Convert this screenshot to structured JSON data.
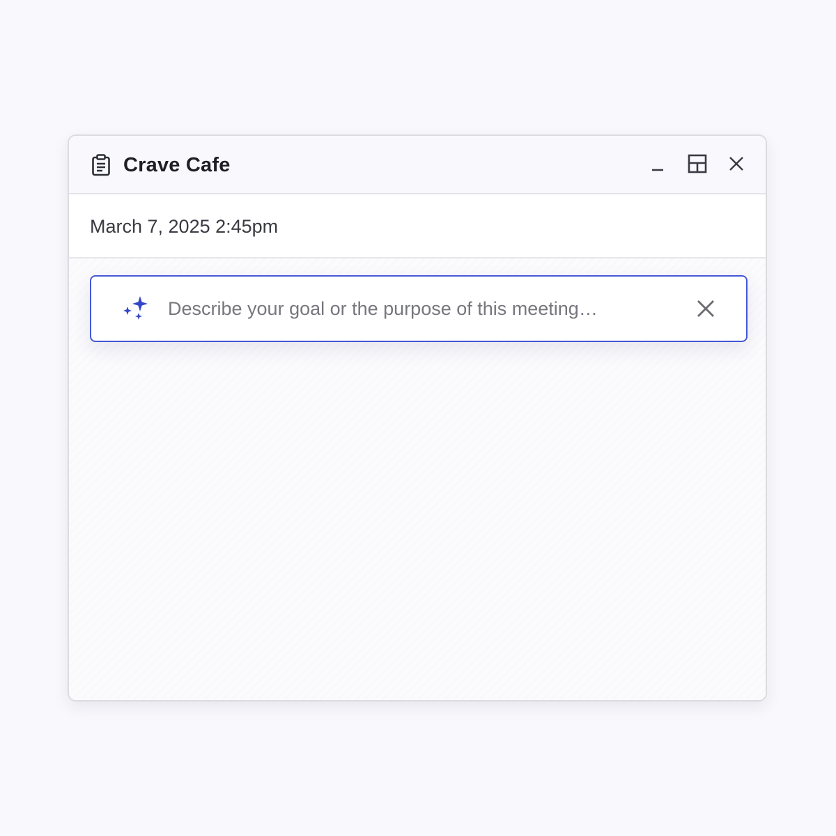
{
  "window": {
    "title": "Crave Cafe",
    "title_icon": "clipboard-icon",
    "controls": {
      "minimize_icon": "minimize-icon",
      "layout_icon": "split-layout-icon",
      "close_icon": "close-icon"
    }
  },
  "meeting": {
    "datetime": "March 7, 2025 2:45pm"
  },
  "prompt": {
    "placeholder": "Describe your goal or the purpose of this meeting…",
    "value": "",
    "icon": "sparkle-icon",
    "clear_icon": "clear-icon"
  },
  "colors": {
    "accent": "#4457d6",
    "sparkle": "#3346c8",
    "background": "#f9f8fc"
  }
}
